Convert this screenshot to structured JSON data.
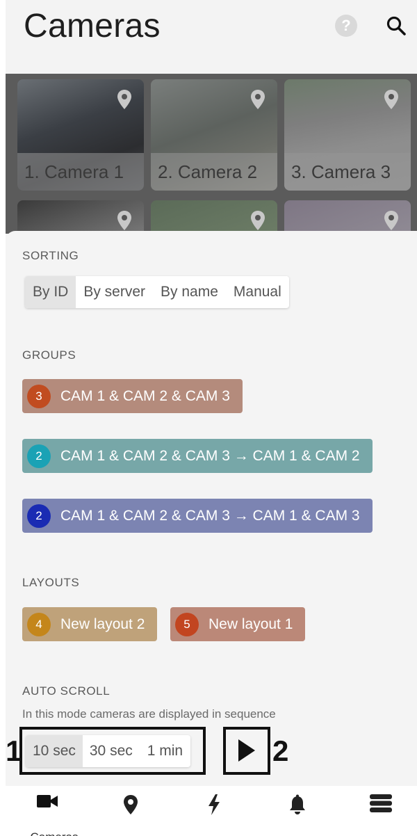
{
  "header": {
    "title": "Cameras"
  },
  "cameras": [
    {
      "label": "1. Camera 1"
    },
    {
      "label": "2. Camera 2"
    },
    {
      "label": "3. Camera 3"
    }
  ],
  "sorting": {
    "title": "SORTING",
    "options": [
      "By ID",
      "By server",
      "By name",
      "Manual"
    ],
    "selected": "By ID"
  },
  "groups": {
    "title": "GROUPS",
    "items": [
      {
        "count": "3",
        "name": "CAM 1 & CAM 2 & CAM 3",
        "color": "#b48b7c",
        "badge_color": "#c14c20"
      },
      {
        "count": "2",
        "name": "CAM 1 & CAM 2 & CAM 3 → CAM 1 & CAM 2",
        "color": "#77a7a8",
        "badge_color": "#1aa2b5"
      },
      {
        "count": "2",
        "name": "CAM 1 & CAM 2 & CAM 3 → CAM 1 & CAM 3",
        "color": "#7c84b2",
        "badge_color": "#1a2bb3"
      }
    ]
  },
  "layouts": {
    "title": "LAYOUTS",
    "items": [
      {
        "count": "4",
        "name": "New layout 2",
        "color": "#bfa27a",
        "badge_color": "#c4861b"
      },
      {
        "count": "5",
        "name": "New layout 1",
        "color": "#bb8878",
        "badge_color": "#c24520"
      }
    ]
  },
  "auto_scroll": {
    "title": "AUTO SCROLL",
    "description": "In this mode cameras are displayed in sequence",
    "options": [
      "10 sec",
      "30 sec",
      "1 min"
    ],
    "selected": "10 sec"
  },
  "annotations": {
    "mark1": "1",
    "mark2": "2"
  },
  "nav": {
    "items": [
      {
        "icon": "video-camera-icon",
        "label": "Cameras"
      },
      {
        "icon": "map-pin-icon",
        "label": ""
      },
      {
        "icon": "lightning-icon",
        "label": ""
      },
      {
        "icon": "bell-icon",
        "label": ""
      },
      {
        "icon": "server-icon",
        "label": ""
      }
    ]
  }
}
